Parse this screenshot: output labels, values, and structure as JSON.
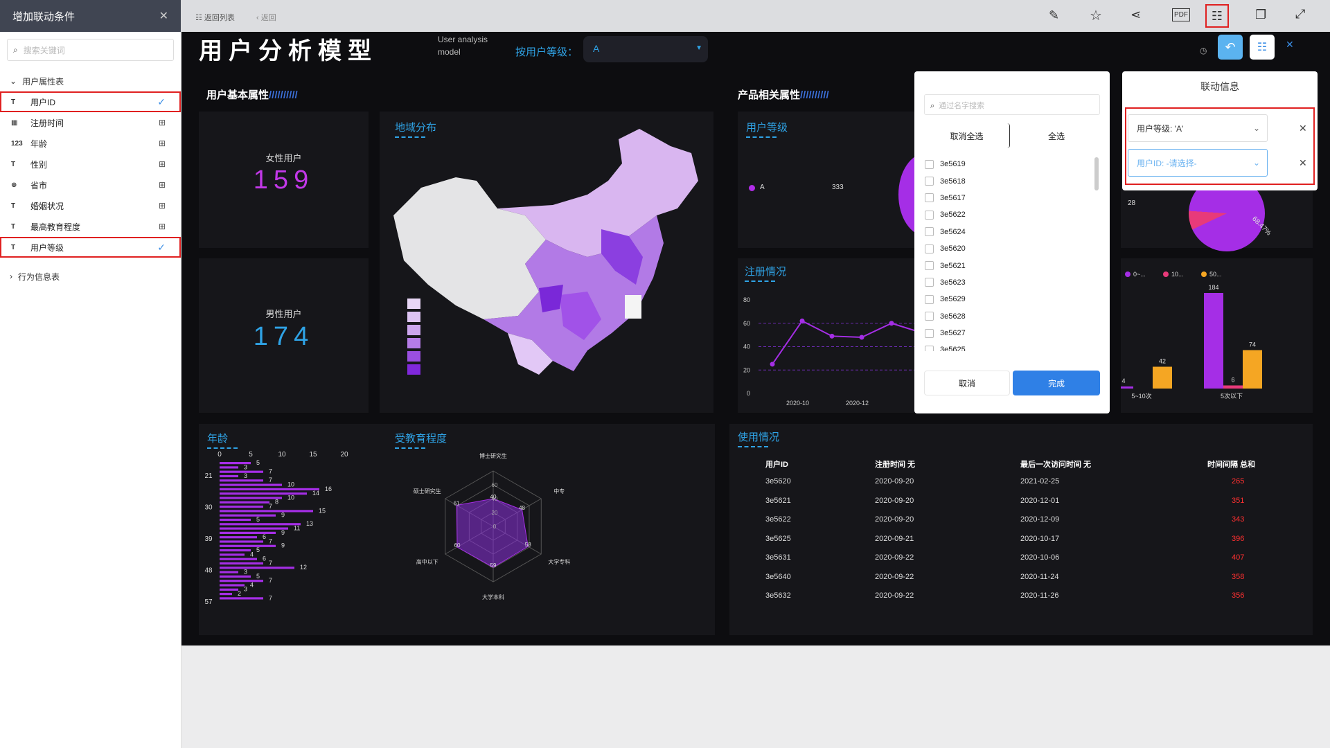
{
  "left_panel": {
    "title": "增加联动条件",
    "search_placeholder": "搜索关键词",
    "table1": "用户属性表",
    "table2": "行为信息表",
    "fields": [
      {
        "type": "T",
        "label": "用户ID"
      },
      {
        "type": "▦",
        "label": "注册时间"
      },
      {
        "type": "123",
        "label": "年龄"
      },
      {
        "type": "T",
        "label": "性别"
      },
      {
        "type": "⊕",
        "label": "省市"
      },
      {
        "type": "T",
        "label": "婚姻状况"
      },
      {
        "type": "T",
        "label": "最高教育程度"
      },
      {
        "type": "T",
        "label": "用户等级"
      }
    ]
  },
  "topbar": {
    "back_list": "返回列表",
    "back": "返回"
  },
  "dashboard": {
    "title": "用户分析模型",
    "subtitle1": "User analysis",
    "subtitle2": "model",
    "filter_label": "按用户等级：",
    "filter_value": "A",
    "sec_basic": "用户基本属性",
    "sec_product": "产品相关属性",
    "female_label": "女性用户",
    "female_value": "159",
    "male_label": "男性用户",
    "male_value": "174",
    "region_title": "地域分布",
    "level_title": "用户等级",
    "level_legend": "A",
    "level_value": "333",
    "reg_title": "注册情况",
    "age_title": "年龄",
    "edu_title": "受教育程度",
    "usage_title": "使用情况",
    "behavior_legend": [
      "0~...",
      "10...",
      "50..."
    ],
    "behavior_cats": [
      "5~10次",
      "5次以下"
    ],
    "side_val": "28",
    "pie_pct": "68.47%"
  },
  "picker": {
    "search_placeholder": "通过名字搜索",
    "cancel_all": "取消全选",
    "select_all": "全选",
    "options": [
      "3e5619",
      "3e5618",
      "3e5617",
      "3e5622",
      "3e5624",
      "3e5620",
      "3e5621",
      "3e5623",
      "3e5629",
      "3e5628",
      "3e5627",
      "3e5625"
    ],
    "cancel": "取消",
    "done": "完成"
  },
  "linkinfo": {
    "title": "联动信息",
    "cond1": "用户等级: 'A'",
    "cond2": "用户ID: -请选择-"
  },
  "usage_table": {
    "headers": [
      "用户ID",
      "注册时间 无",
      "最后一次访问时间 无",
      "时间间隔 总和"
    ],
    "rows": [
      [
        "3e5620",
        "2020-09-20",
        "2021-02-25",
        "265"
      ],
      [
        "3e5621",
        "2020-09-20",
        "2020-12-01",
        "351"
      ],
      [
        "3e5622",
        "2020-09-20",
        "2020-12-09",
        "343"
      ],
      [
        "3e5625",
        "2020-09-21",
        "2020-10-17",
        "396"
      ],
      [
        "3e5631",
        "2020-09-22",
        "2020-10-06",
        "407"
      ],
      [
        "3e5640",
        "2020-09-22",
        "2020-11-24",
        "358"
      ],
      [
        "3e5632",
        "2020-09-22",
        "2020-11-26",
        "356"
      ]
    ]
  },
  "chart_data": [
    {
      "type": "line",
      "title": "注册情况",
      "x": [
        "2020-10",
        "",
        "2020-12",
        ""
      ],
      "values": [
        25,
        62,
        49,
        48,
        60,
        52
      ],
      "ylim": [
        0,
        80
      ],
      "yticks": [
        0,
        20,
        40,
        60,
        80
      ]
    },
    {
      "type": "bar",
      "title": "年龄",
      "orientation": "horizontal",
      "xticks": [
        0,
        5,
        10,
        15,
        20
      ],
      "ylabels": [
        "21",
        "30",
        "39",
        "48",
        "57"
      ],
      "values": [
        5,
        3,
        7,
        3,
        7,
        10,
        16,
        14,
        10,
        8,
        7,
        15,
        9,
        5,
        13,
        11,
        9,
        6,
        7,
        9,
        5,
        4,
        6,
        7,
        12,
        3,
        5,
        7,
        4,
        3,
        2,
        7
      ]
    },
    {
      "type": "radar",
      "title": "受教育程度",
      "axes": [
        "博士研究生",
        "中专",
        "大学专科",
        "大学本科",
        "高中以下",
        "硕士研究生"
      ],
      "values": [
        40,
        48,
        58,
        59,
        60,
        61
      ],
      "rticks": [
        0,
        20,
        40,
        60
      ]
    },
    {
      "type": "bar",
      "title": "行为",
      "categories": [
        "5~10次",
        "5次以下"
      ],
      "series": [
        {
          "name": "0~...",
          "values": [
            4,
            184
          ]
        },
        {
          "name": "10...",
          "values": [
            0,
            6
          ]
        },
        {
          "name": "50...",
          "values": [
            42,
            74
          ]
        }
      ]
    }
  ]
}
